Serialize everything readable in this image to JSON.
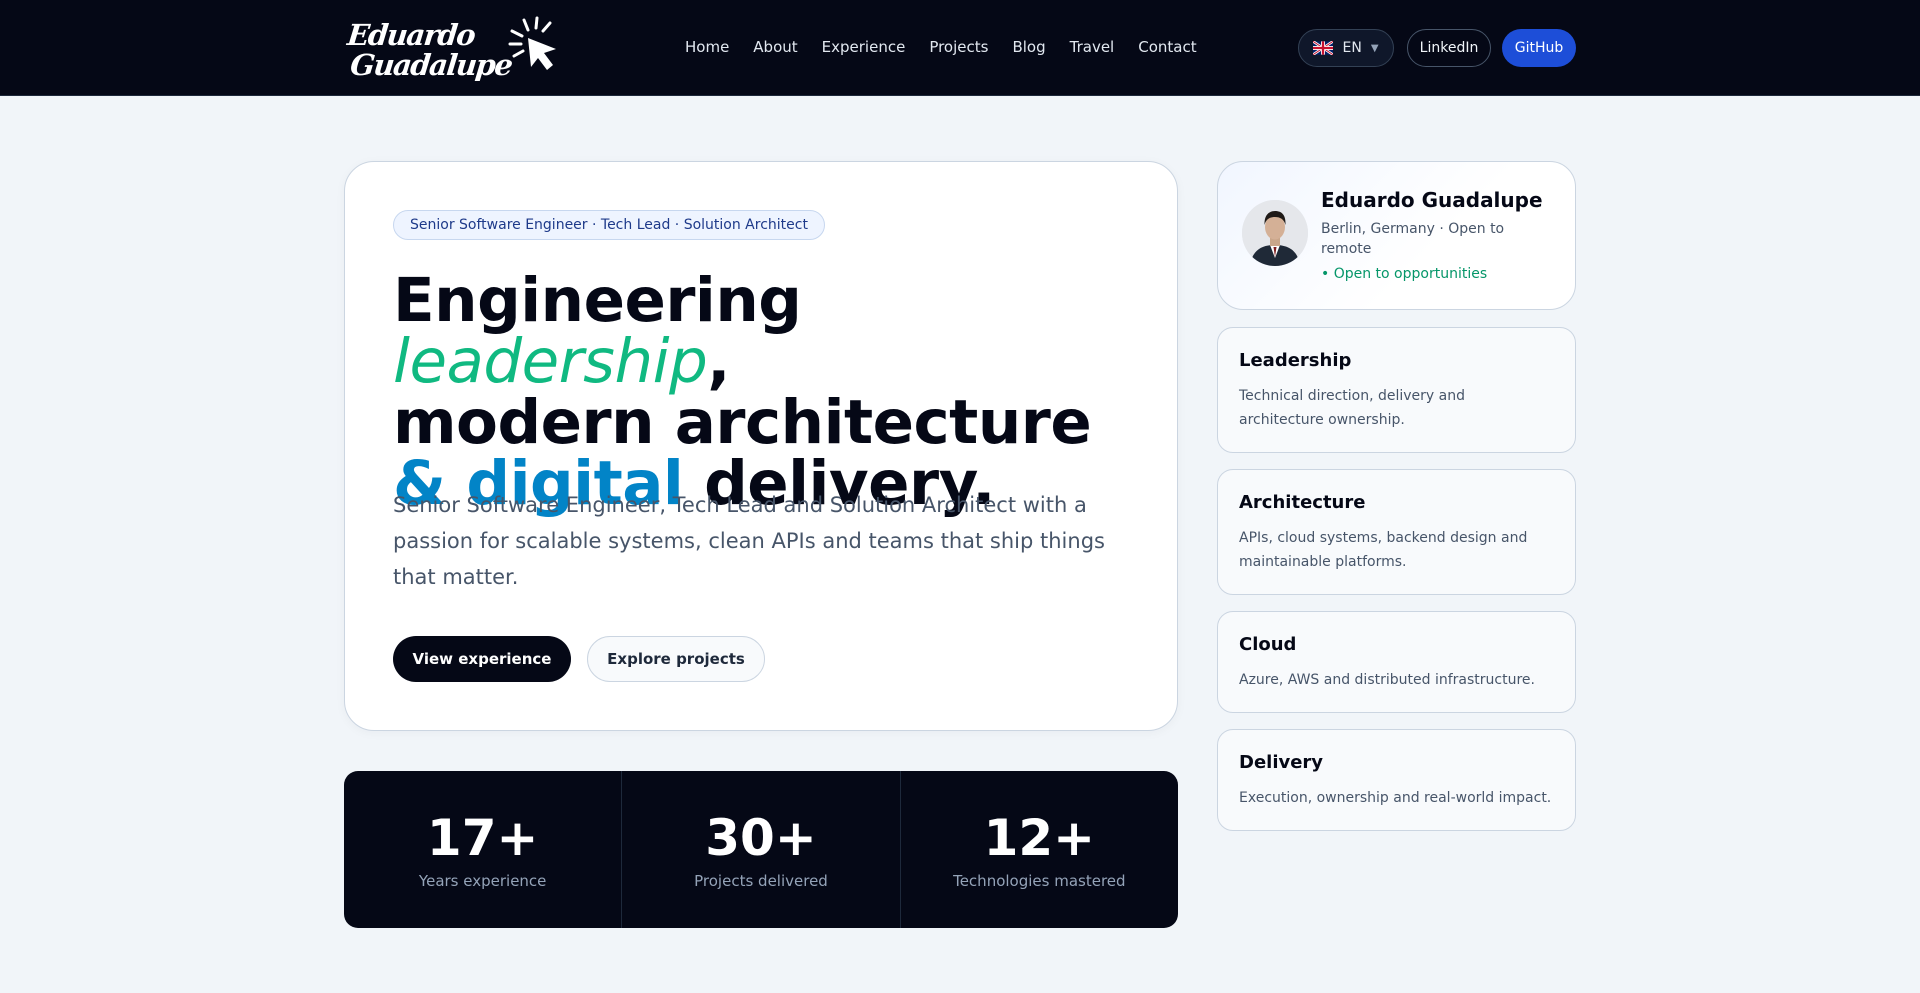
{
  "header": {
    "brand": {
      "line1": "Eduardo",
      "line2": "Guadalupe"
    },
    "nav": [
      "Home",
      "About",
      "Experience",
      "Projects",
      "Blog",
      "Travel",
      "Contact"
    ],
    "language": {
      "code": "EN",
      "flag_icon": "uk-flag-icon"
    },
    "linkedin_label": "LinkedIn",
    "github_label": "GitHub"
  },
  "hero": {
    "badge": "Senior Software Engineer · Tech Lead · Solution Architect",
    "headline": {
      "part1": "Engineering ",
      "part2": "leadership",
      "part3": ",",
      "part4": "modern architecture",
      "part5": "& digital",
      "part6": " delivery."
    },
    "lede": "Senior Software Engineer, Tech Lead and Solution Architect with a passion for scalable systems, clean APIs and teams that ship things that matter.",
    "primary_cta": "View experience",
    "secondary_cta": "Explore projects"
  },
  "stats": [
    {
      "value": "17+",
      "label": "Years experience"
    },
    {
      "value": "30+",
      "label": "Projects delivered"
    },
    {
      "value": "12+",
      "label": "Technologies mastered"
    }
  ],
  "profile": {
    "name": "Eduardo Guadalupe",
    "location": "Berlin, Germany · Open to remote",
    "status": "• Open to opportunities"
  },
  "features": [
    {
      "title": "Leadership",
      "description": "Technical direction, delivery and architecture ownership."
    },
    {
      "title": "Architecture",
      "description": "APIs, cloud systems, backend design and maintainable platforms."
    },
    {
      "title": "Cloud",
      "description": "Azure, AWS and distributed infrastructure."
    },
    {
      "title": "Delivery",
      "description": "Execution, ownership and real-world impact."
    }
  ],
  "colors": {
    "navy": "#050816",
    "accent_green": "#10b981",
    "accent_blue": "#0284c7",
    "github_blue": "#1d4ed8"
  }
}
